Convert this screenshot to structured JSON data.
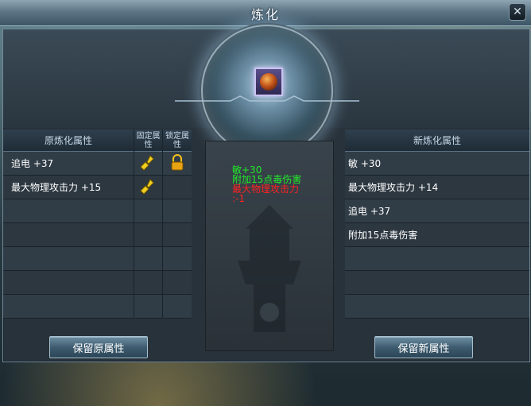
{
  "window": {
    "title": "炼化",
    "close_icon": "close-icon"
  },
  "item_slot": {
    "icon": "gem-icon"
  },
  "left_table": {
    "header": {
      "attribute": "原炼化属性",
      "fix": "固定属性",
      "lock": "锁定属性"
    },
    "rows": [
      {
        "label": "追电 +37",
        "fixed_icon": "chain-icon",
        "lock_icon": "lock-icon"
      },
      {
        "label": "最大物理攻击力 +15",
        "fixed_icon": "chain-icon",
        "lock_icon": ""
      },
      {
        "label": ""
      },
      {
        "label": ""
      },
      {
        "label": ""
      },
      {
        "label": ""
      },
      {
        "label": ""
      }
    ]
  },
  "center": {
    "lines": [
      {
        "text": "敏+30",
        "color": "#22e82a"
      },
      {
        "text": "附加15点毒伤害",
        "color": "#22e82a"
      },
      {
        "text": "最大物理攻击力",
        "color": "#ff2222"
      },
      {
        "text": ":-1",
        "color": "#ff2222"
      }
    ]
  },
  "right_table": {
    "header": {
      "attribute": "新炼化属性"
    },
    "rows": [
      {
        "label": "敏 +30"
      },
      {
        "label": "最大物理攻击力 +14"
      },
      {
        "label": "追电 +37"
      },
      {
        "label": "附加15点毒伤害"
      },
      {
        "label": ""
      },
      {
        "label": ""
      },
      {
        "label": ""
      }
    ]
  },
  "buttons": {
    "keep_old": "保留原属性",
    "keep_new": "保留新属性"
  }
}
